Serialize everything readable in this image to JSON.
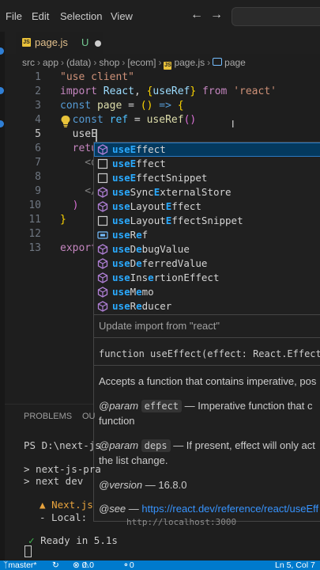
{
  "menubar": {
    "items": [
      "File",
      "Edit",
      "Selection",
      "View"
    ]
  },
  "tab": {
    "filename": "page.js",
    "status": "U"
  },
  "breadcrumb": {
    "parts": [
      "src",
      "app",
      "(data)",
      "shop",
      "[ecom]",
      "page.js",
      "page"
    ]
  },
  "editor": {
    "line_numbers": [
      "1",
      "2",
      "3",
      "4",
      "5",
      "6",
      "7",
      "8",
      "9",
      "10",
      "11",
      "12",
      "13"
    ],
    "active_line": "5",
    "lines": [
      [
        {
          "t": "\"use client\"",
          "c": "str"
        }
      ],
      [
        {
          "t": "import ",
          "c": "kw2"
        },
        {
          "t": "React",
          "c": "var"
        },
        {
          "t": ", ",
          "c": "plain"
        },
        {
          "t": "{",
          "c": "br1"
        },
        {
          "t": "useRef",
          "c": "var"
        },
        {
          "t": "}",
          "c": "br1"
        },
        {
          "t": " from ",
          "c": "kw2"
        },
        {
          "t": "'react'",
          "c": "str"
        }
      ],
      [
        {
          "t": "const ",
          "c": "kw"
        },
        {
          "t": "page",
          "c": "fn"
        },
        {
          "t": " = ",
          "c": "plain"
        },
        {
          "t": "()",
          "c": "br1"
        },
        {
          "t": " => ",
          "c": "kw"
        },
        {
          "t": "{",
          "c": "br1"
        }
      ],
      [
        {
          "t": "  const ",
          "c": "kw"
        },
        {
          "t": "ref",
          "c": "cst"
        },
        {
          "t": " = ",
          "c": "plain"
        },
        {
          "t": "useRef",
          "c": "fn"
        },
        {
          "t": "()",
          "c": "br2"
        }
      ],
      [
        {
          "t": "  useE",
          "c": "plain"
        }
      ],
      [
        {
          "t": "  retu",
          "c": "kw2"
        }
      ],
      [
        {
          "t": "    <d",
          "c": "gray"
        }
      ],
      [
        {
          "t": "",
          "c": "plain"
        }
      ],
      [
        {
          "t": "    </",
          "c": "gray"
        }
      ],
      [
        {
          "t": "  )",
          "c": "br2"
        }
      ],
      [
        {
          "t": "}",
          "c": "br1"
        }
      ],
      [
        {
          "t": "",
          "c": "plain"
        }
      ],
      [
        {
          "t": "export",
          "c": "kw2"
        }
      ]
    ]
  },
  "suggestions": [
    {
      "pre": "useE",
      "rest": "ffect",
      "post": "",
      "icon": "cube"
    },
    {
      "pre": "useE",
      "rest": "ffect",
      "post": "",
      "icon": "square"
    },
    {
      "pre": "useE",
      "rest": "ffectSnippet",
      "post": "",
      "icon": "square"
    },
    {
      "pre": "useSyncE",
      "rest": "xternalStore",
      "post": "",
      "icon": "cube"
    },
    {
      "pre": "useLayoutE",
      "rest": "ffect",
      "post": "",
      "icon": "cube"
    },
    {
      "pre": "useLayoutE",
      "rest": "ffectSnippet",
      "post": "",
      "icon": "square"
    },
    {
      "pre": "useRef",
      "rest": "",
      "post": "",
      "icon": "var"
    },
    {
      "pre": "useDebugValue",
      "rest": "",
      "post": "",
      "icon": "cube"
    },
    {
      "pre": "useDeferredValue",
      "rest": "",
      "post": "",
      "icon": "cube"
    },
    {
      "pre": "useInsertionE",
      "rest": "ffect",
      "post": "",
      "icon": "cube"
    },
    {
      "pre": "useMemo",
      "rest": "",
      "post": "",
      "icon": "cube"
    },
    {
      "pre": "useReducer",
      "rest": "",
      "post": "",
      "icon": "cube"
    }
  ],
  "suggest_matches": [
    [
      "useE"
    ],
    [
      "useE"
    ],
    [
      "useE"
    ],
    [
      "use",
      "E"
    ],
    [
      "use",
      "E"
    ],
    [
      "use",
      "E"
    ],
    [
      "useRe"
    ],
    [
      "useDe"
    ],
    [
      "useDe"
    ],
    [
      "use",
      "E"
    ],
    [
      "useMe"
    ],
    [
      "useRe"
    ]
  ],
  "detail": {
    "import_line": "Update import from \"react\"",
    "signature": "function useEffect(effect: React.Effect",
    "description": "Accepts a function that contains imperative, pos",
    "param1_tag": "@param",
    "param1_name": "effect",
    "param1_text": " — Imperative function that c",
    "param1_cont": "function",
    "param2_tag": "@param",
    "param2_name": "deps",
    "param2_text": " — If present, effect will only act",
    "param2_cont": "the list change.",
    "version_tag": "@version",
    "version_text": " — 16.8.0",
    "see_tag": "@see",
    "see_dash": " — ",
    "see_link": "https://react.dev/reference/react/useEff"
  },
  "panel": {
    "tab_problems": "PROBLEMS",
    "tab_output": "OU"
  },
  "terminal": {
    "prompt": "PS D:\\next-js",
    "line1": "> next-js-pra",
    "line2": "> next dev",
    "next_label": "Next.js",
    "local_label": "- Local:",
    "local_url": "http://localhost:3000",
    "ready": "Ready in 5.1s"
  },
  "statusbar": {
    "branch": "master*",
    "errors": "0",
    "warnings": "0",
    "ports": "0",
    "position": "Ln 5, Col 7"
  },
  "colors": {
    "accent": "#007acc",
    "selection": "#04395e",
    "match": "#2aaaff"
  }
}
